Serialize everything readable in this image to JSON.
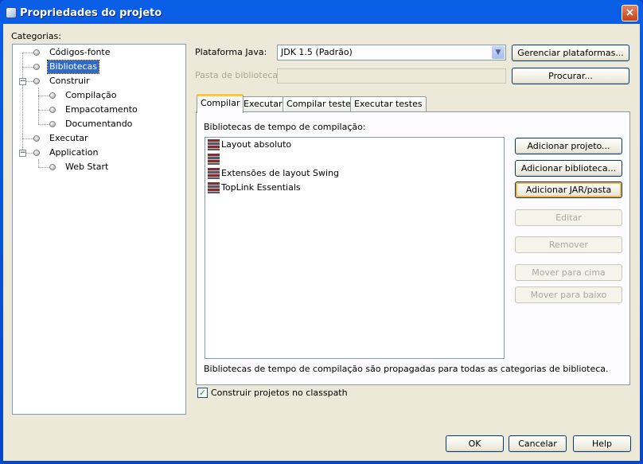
{
  "window": {
    "title": "Propriedades do projeto",
    "close": "×"
  },
  "categories": {
    "label": "Categorias:",
    "items": [
      {
        "label": "Códigos-fonte"
      },
      {
        "label": "Bibliotecas"
      },
      {
        "label": "Construir"
      },
      {
        "label": "Compilação"
      },
      {
        "label": "Empacotamento"
      },
      {
        "label": "Documentando"
      },
      {
        "label": "Executar"
      },
      {
        "label": "Application"
      },
      {
        "label": "Web Start"
      }
    ],
    "selected": "Bibliotecas"
  },
  "platform": {
    "label": "Plataforma Java:",
    "value": "JDK 1.5 (Padrão)",
    "manage_button": "Gerenciar plataformas..."
  },
  "lib_folder": {
    "label": "Pasta de bibliotecas:",
    "value": "",
    "browse_button": "Procurar..."
  },
  "tabs": [
    {
      "label": "Compilar"
    },
    {
      "label": "Executar"
    },
    {
      "label": "Compilar testes"
    },
    {
      "label": "Executar testes"
    }
  ],
  "compile": {
    "list_label": "Bibliotecas de tempo de compilação:",
    "libraries": [
      "Layout absoluto",
      "",
      "Extensões de layout Swing",
      "TopLink Essentials"
    ],
    "buttons": {
      "add_project": "Adicionar projeto...",
      "add_library": "Adicionar biblioteca...",
      "add_jar": "Adicionar JAR/pasta",
      "edit": "Editar",
      "remove": "Remover",
      "move_up": "Mover para cima",
      "move_down": "Mover para baixo"
    },
    "note": "Bibliotecas de tempo de compilação são propagadas para todas as categorias de biblioteca."
  },
  "build_checkbox": {
    "label": "Construir projetos no classpath",
    "checked": true
  },
  "footer": {
    "ok": "OK",
    "cancel": "Cancelar",
    "help": "Help"
  }
}
